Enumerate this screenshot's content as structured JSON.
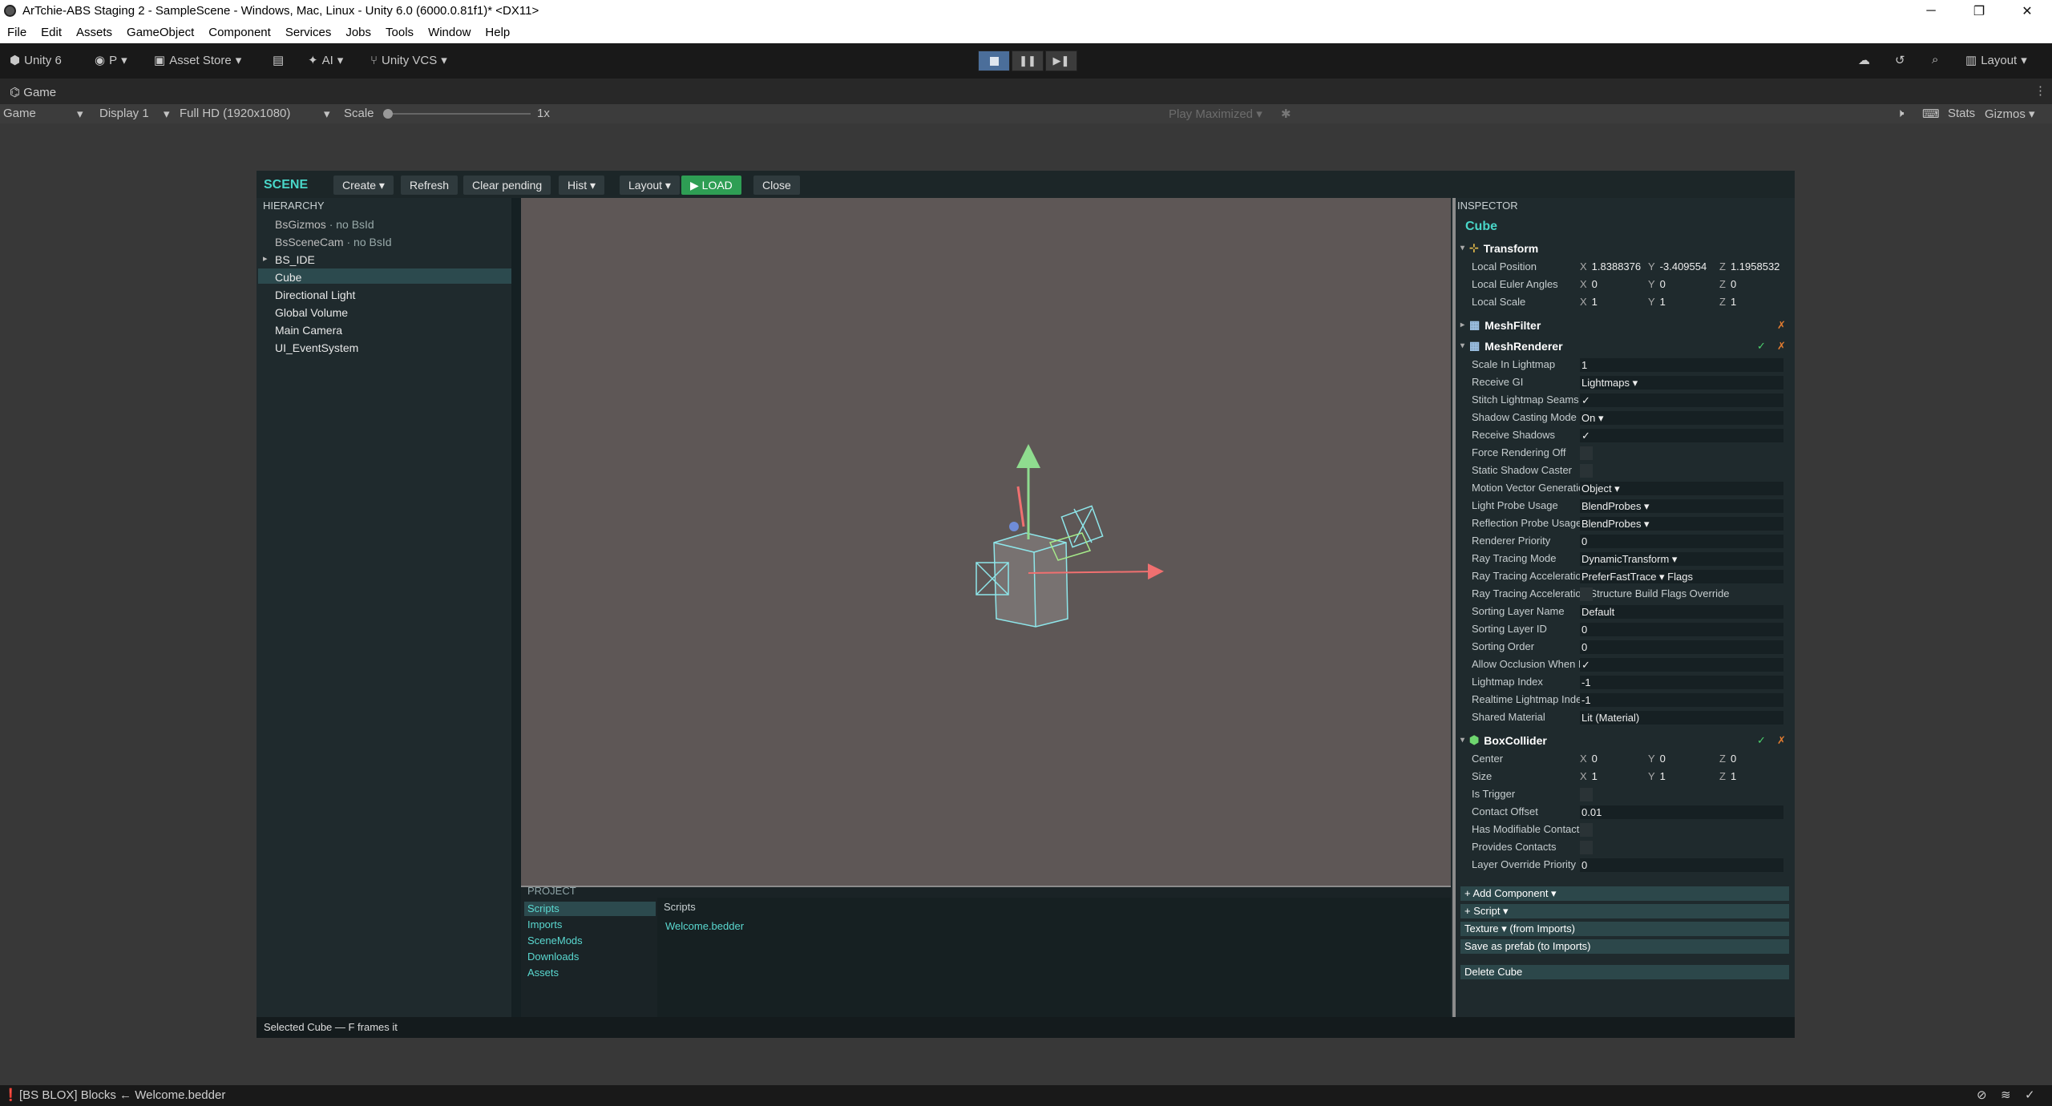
{
  "window": {
    "title": "ArTchie-ABS Staging 2 - SampleScene - Windows, Mac, Linux - Unity 6.0 (6000.0.81f1)* <DX11>"
  },
  "menu": [
    "File",
    "Edit",
    "Assets",
    "GameObject",
    "Component",
    "Services",
    "Jobs",
    "Tools",
    "Window",
    "Help"
  ],
  "toolbar": {
    "unity_label": "Unity 6",
    "account_label": "P",
    "asset_store_label": "Asset Store",
    "ai_label": "AI",
    "vcs_label": "Unity VCS",
    "layout_label": "Layout"
  },
  "game_tab": {
    "label": "Game"
  },
  "game_bar": {
    "mode": "Game",
    "display": "Display 1",
    "resolution": "Full HD (1920x1080)",
    "scale_label": "Scale",
    "scale_value": "1x",
    "play_mode": "Play Maximized",
    "stats": "Stats",
    "gizmos": "Gizmos"
  },
  "app": {
    "title": "SCENE",
    "buttons": {
      "create": "Create ▾",
      "refresh": "Refresh",
      "clear": "Clear pending",
      "hist": "Hist ▾",
      "layout": "Layout ▾",
      "load": "▶ LOAD",
      "close": "Close"
    },
    "hierarchy": {
      "title": "HIERARCHY",
      "items": [
        {
          "label": "BsGizmos",
          "note": "· no BsId"
        },
        {
          "label": "BsSceneCam",
          "note": "· no BsId"
        },
        {
          "label": "BS_IDE",
          "note": ""
        },
        {
          "label": "Cube",
          "note": ""
        },
        {
          "label": "Directional Light",
          "note": ""
        },
        {
          "label": "Global Volume",
          "note": ""
        },
        {
          "label": "Main Camera",
          "note": ""
        },
        {
          "label": "UI_EventSystem",
          "note": ""
        }
      ]
    },
    "project": {
      "title": "PROJECT",
      "folders": [
        "Scripts",
        "Imports",
        "SceneMods",
        "Downloads",
        "Assets"
      ],
      "current": "Scripts",
      "files": [
        "Welcome.bedder"
      ]
    },
    "status": "Selected Cube — F frames it"
  },
  "inspector": {
    "title": "INSPECTOR",
    "object": "Cube",
    "transform": {
      "name": "Transform",
      "position_label": "Local Position",
      "position": [
        "1.8388376",
        "-3.409554",
        "1.1958532"
      ],
      "rotation_label": "Local Euler Angles",
      "rotation": [
        "0",
        "0",
        "0"
      ],
      "scale_label": "Local Scale",
      "scale": [
        "1",
        "1",
        "1"
      ]
    },
    "meshfilter": "MeshFilter",
    "meshrenderer": {
      "name": "MeshRenderer",
      "rows": [
        {
          "label": "Scale In Lightmap",
          "value": "1"
        },
        {
          "label": "Receive GI",
          "value": "Lightmaps ▾"
        },
        {
          "label": "Stitch Lightmap Seams",
          "value": "✓"
        },
        {
          "label": "Shadow Casting Mode",
          "value": "On ▾"
        },
        {
          "label": "Receive Shadows",
          "value": "✓"
        },
        {
          "label": "Force Rendering Off",
          "value": ""
        },
        {
          "label": "Static Shadow Caster",
          "value": ""
        },
        {
          "label": "Motion Vector Generation Mode",
          "value": "Object ▾"
        },
        {
          "label": "Light Probe Usage",
          "value": "BlendProbes ▾"
        },
        {
          "label": "Reflection Probe Usage",
          "value": "BlendProbes ▾"
        },
        {
          "label": "Renderer Priority",
          "value": "0"
        },
        {
          "label": "Ray Tracing Mode",
          "value": "DynamicTransform ▾"
        },
        {
          "label": "Ray Tracing Acceleration",
          "value": "PreferFastTrace ▾ Flags"
        },
        {
          "label": "Ray Tracing Acceleration Structure Build Flags Override",
          "value": ""
        },
        {
          "label": "Sorting Layer Name",
          "value": "Default"
        },
        {
          "label": "Sorting Layer ID",
          "value": "0"
        },
        {
          "label": "Sorting Order",
          "value": "0"
        },
        {
          "label": "Allow Occlusion When Dynamic",
          "value": "✓"
        },
        {
          "label": "Lightmap Index",
          "value": "-1"
        },
        {
          "label": "Realtime Lightmap Index",
          "value": "-1"
        },
        {
          "label": "Shared Material",
          "value": "Lit (Material)"
        }
      ]
    },
    "boxcollider": {
      "name": "BoxCollider",
      "center_label": "Center",
      "center": [
        "0",
        "0",
        "0"
      ],
      "size_label": "Size",
      "size": [
        "1",
        "1",
        "1"
      ],
      "rows": [
        {
          "label": "Is Trigger",
          "value": ""
        },
        {
          "label": "Contact Offset",
          "value": "0.01"
        },
        {
          "label": "Has Modifiable Contacts",
          "value": ""
        },
        {
          "label": "Provides Contacts",
          "value": ""
        },
        {
          "label": "Layer Override Priority",
          "value": "0"
        }
      ]
    },
    "actions": {
      "add_component": "+ Add Component ▾",
      "script": "+ Script ▾",
      "texture": "Texture ▾ (from Imports)",
      "save_prefab": "Save as prefab (to Imports)",
      "delete": "Delete Cube"
    }
  },
  "console": {
    "message": "[BS BLOX] Blocks ← Welcome.bedder"
  }
}
